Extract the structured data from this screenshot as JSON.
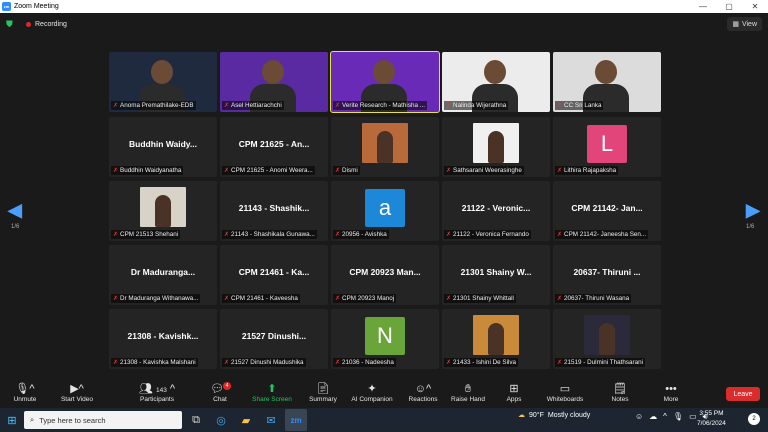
{
  "window": {
    "title": "Zoom Meeting",
    "app_icon": "zm"
  },
  "topbar": {
    "recording_label": "Recording",
    "view_label": "View"
  },
  "pager": {
    "left_page": "1/6",
    "right_page": "1/6"
  },
  "tiles": [
    {
      "name": "Anoma Premathilake-EDB",
      "big": "",
      "kind": "video",
      "bg": "#1f2a3f",
      "pinned": false
    },
    {
      "name": "Asel Hettiarachchi",
      "big": "",
      "kind": "video",
      "bg": "#5a2aa3",
      "pinned": false
    },
    {
      "name": "Verite Research - Mathisha ...",
      "big": "",
      "kind": "video",
      "bg": "#6a2ab8",
      "pinned": false,
      "active": true
    },
    {
      "name": "Nalinda Wijerathna",
      "big": "",
      "kind": "video",
      "bg": "#ececec",
      "pinned": false
    },
    {
      "name": "CC Sri Lanka",
      "big": "",
      "kind": "video",
      "bg": "#dcdcdc",
      "pinned": false
    },
    {
      "name": "Buddhin Waidyanatha",
      "big": "Buddhin  Waidy...",
      "kind": "name"
    },
    {
      "name": "CPM 21625 - Anomi Weera...",
      "big": "CPM 21625 - An...",
      "kind": "name"
    },
    {
      "name": "Dismi",
      "big": "",
      "kind": "photo",
      "bg": "#b86a3a"
    },
    {
      "name": "Sathsarani Weerasinghe",
      "big": "",
      "kind": "photo",
      "bg": "#f0f0f0"
    },
    {
      "name": "Lithira Rajapaksha",
      "big": "",
      "kind": "avatar",
      "letter": "L",
      "bg": "#e1457a"
    },
    {
      "name": "CPM 21513 Shehani",
      "big": "",
      "kind": "photo",
      "bg": "#d8d2c8"
    },
    {
      "name": "21143 - Shashikala Gunawa...",
      "big": "21143 - Shashik...",
      "kind": "name"
    },
    {
      "name": "20956 - Avishka",
      "big": "",
      "kind": "avatar",
      "letter": "a",
      "bg": "#1e88d8"
    },
    {
      "name": "21122 - Veronica Fernando",
      "big": "21122 - Veronic...",
      "kind": "name"
    },
    {
      "name": "CPM 21142- Janeesha Sen...",
      "big": "CPM 21142- Jan...",
      "kind": "name"
    },
    {
      "name": "Dr Maduranga Withanawa...",
      "big": "Dr  Maduranga...",
      "kind": "name"
    },
    {
      "name": "21461 - Kaveesha",
      "big": "CPM 21461 - Ka...",
      "kind": "name",
      "label_override": "CPM 21461 - Kaveesha"
    },
    {
      "name": "CPM 20923 Manoj",
      "big": "CPM 20923 Man...",
      "kind": "name"
    },
    {
      "name": "21301 Shainy Whittall",
      "big": "21301 Shainy W...",
      "kind": "name"
    },
    {
      "name": "20637- Thiruni Wasana",
      "big": "20637- Thiruni ...",
      "kind": "name"
    },
    {
      "name": "21308 - Kavishka Malshani",
      "big": "21308 - Kavishk...",
      "kind": "name"
    },
    {
      "name": "21527 Dinushi Madushika",
      "big": "21527 Dinushi...",
      "kind": "name"
    },
    {
      "name": "21036 - Nadeesha",
      "big": "",
      "kind": "avatar",
      "letter": "N",
      "bg": "#6aa53a"
    },
    {
      "name": "21433 - Ishini De Silva",
      "big": "",
      "kind": "photo",
      "bg": "#c98a3a"
    },
    {
      "name": "21519 - Dulmini Thathsarani",
      "big": "",
      "kind": "photo",
      "bg": "#2a2a3a"
    }
  ],
  "toolbar": {
    "unmute": "Unmute",
    "start_video": "Start Video",
    "participants": "Participants",
    "participants_count": "143",
    "chat": "Chat",
    "chat_badge": "4",
    "share_screen": "Share Screen",
    "summary": "Summary",
    "ai_companion": "AI Companion",
    "reactions": "Reactions",
    "raise_hand": "Raise Hand",
    "apps": "Apps",
    "whiteboards": "Whiteboards",
    "notes": "Notes",
    "more": "More",
    "leave": "Leave"
  },
  "taskbar": {
    "search_placeholder": "Type here to search",
    "weather_temp": "90°F",
    "weather_desc": "Mostly cloudy",
    "time": "3:55 PM",
    "date": "7/06/2024",
    "notifications": "2"
  },
  "colors": {
    "accent": "#2d8cff",
    "leave": "#d92c2c",
    "share": "#22c55e",
    "active_speaker": "#e6e34a"
  }
}
